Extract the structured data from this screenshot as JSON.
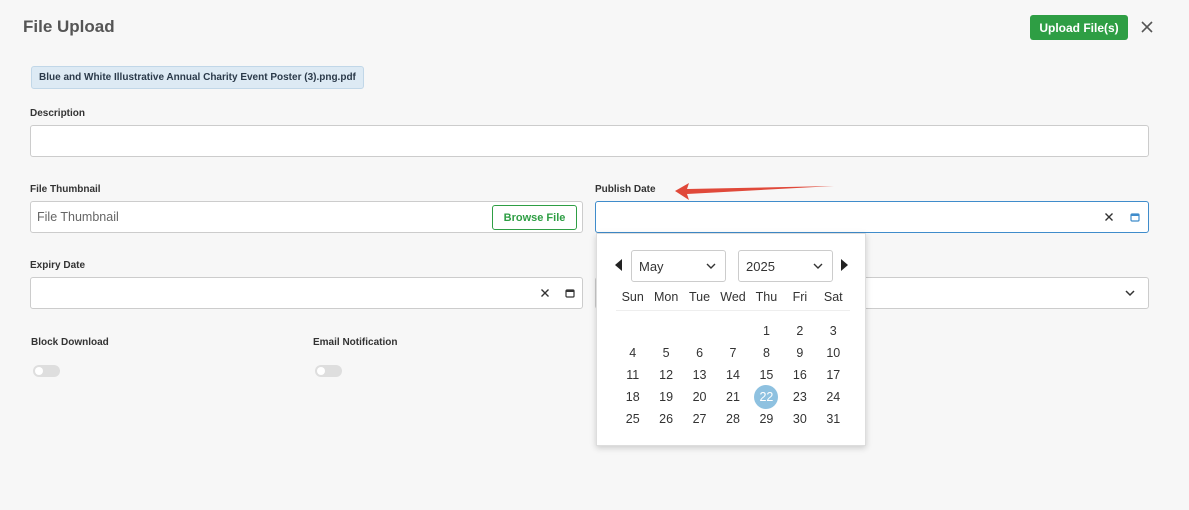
{
  "header": {
    "title": "File Upload",
    "upload_label": "Upload File(s)"
  },
  "file": {
    "name": "Blue and White Illustrative Annual Charity Event Poster (3).png.pdf"
  },
  "form": {
    "description_label": "Description",
    "description_value": "",
    "thumbnail_label": "File Thumbnail",
    "thumbnail_placeholder": "File Thumbnail",
    "browse_label": "Browse File",
    "publish_label": "Publish Date",
    "publish_value": "",
    "expiry_label": "Expiry Date",
    "expiry_value": "",
    "block_download_label": "Block Download",
    "block_download_on": false,
    "email_notification_label": "Email Notification",
    "email_notification_on": false
  },
  "calendar": {
    "month": "May",
    "year": "2025",
    "weekdays": [
      "Sun",
      "Mon",
      "Tue",
      "Wed",
      "Thu",
      "Fri",
      "Sat"
    ],
    "first_weekday_index": 4,
    "days_in_month": 31,
    "selected_day": 22
  },
  "colors": {
    "primary_green": "#2e9e44",
    "selected_day": "#8ec1e0",
    "annotation_arrow": "#e0493a"
  }
}
